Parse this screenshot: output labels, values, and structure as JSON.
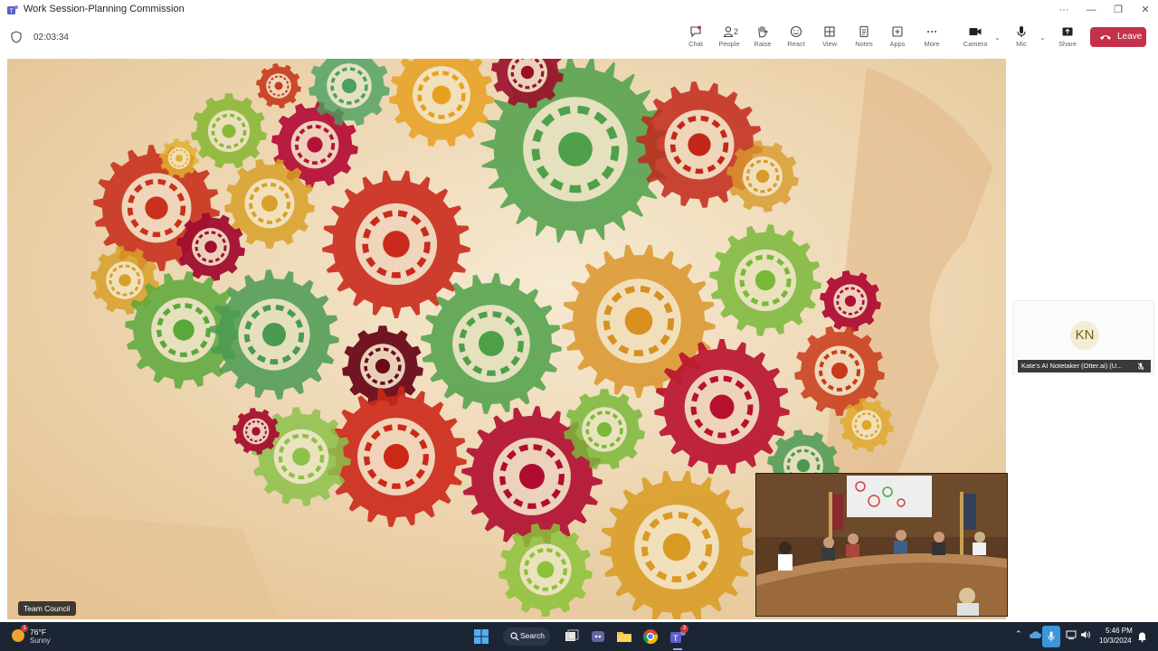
{
  "window": {
    "title": "Work Session-Planning Commission",
    "controls": {
      "more": "···",
      "minimize": "—",
      "restore": "❐",
      "close": "✕"
    }
  },
  "meeting": {
    "elapsed": "02:03:34",
    "toolbar": {
      "chat": "Chat",
      "people": "People",
      "people_count": "2",
      "raise": "Raise",
      "react": "React",
      "view": "View",
      "notes": "Notes",
      "apps": "Apps",
      "more": "More",
      "camera": "Camera",
      "mic": "Mic",
      "share": "Share",
      "leave": "Leave"
    },
    "stage_label": "Team Council",
    "participant": {
      "initials": "KN",
      "name": "Kate's AI Notetaker (Otter.ai) (U..."
    }
  },
  "taskbar": {
    "weather_temp": "76°F",
    "weather_cond": "Sunny",
    "weather_badge": "1",
    "search_label": "Search",
    "teams_badge": "3",
    "time": "5:46 PM",
    "date": "10/3/2024"
  },
  "colors": {
    "leave": "#c4314b",
    "taskbar": "#1c2533",
    "accent": "#3a96dd"
  }
}
